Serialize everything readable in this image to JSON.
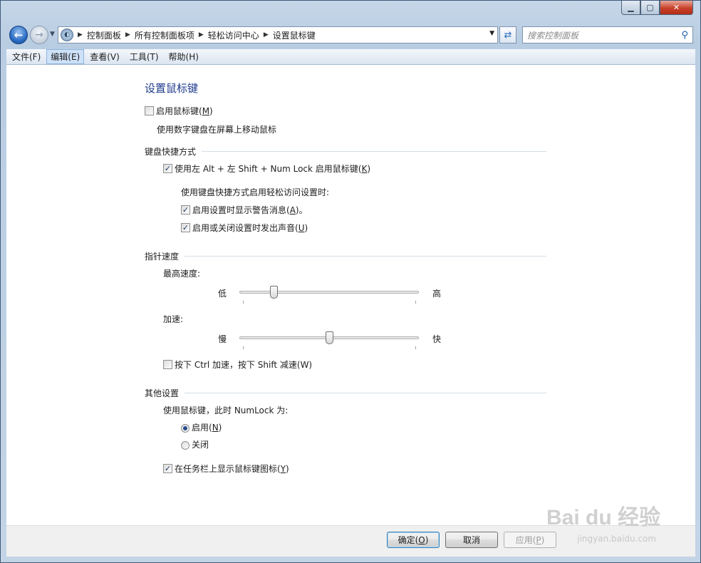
{
  "window": {
    "min": "0",
    "max": "1",
    "close": "r"
  },
  "nav": {
    "back_glyph": "←",
    "forward_glyph": "→",
    "breadcrumbs": [
      "控制面板",
      "所有控制面板项",
      "轻松访问中心",
      "设置鼠标键"
    ],
    "search_placeholder": "搜索控制面板"
  },
  "menu": [
    "文件(F)",
    "编辑(E)",
    "查看(V)",
    "工具(T)",
    "帮助(H)"
  ],
  "page": {
    "title": "设置鼠标键",
    "enable_mouse_keys": {
      "pre": "启用鼠标键(",
      "key": "M",
      "post": ")",
      "checked": false
    },
    "enable_desc": "使用数字键盘在屏幕上移动鼠标",
    "section_shortcut": "键盘快捷方式",
    "shortcut_cb": {
      "pre": "使用左 Alt + 左 Shift + Num Lock 启用鼠标键(",
      "key": "K",
      "post": ")",
      "checked": true
    },
    "shortcut_desc": "使用键盘快捷方式启用轻松访问设置时:",
    "warn_cb": {
      "pre": "启用设置时显示警告消息(",
      "key": "A",
      "post": ")。",
      "checked": true
    },
    "sound_cb": {
      "pre": "启用或关闭设置时发出声音(",
      "key": "U",
      "post": ")",
      "checked": true
    },
    "section_speed": "指针速度",
    "top_speed_label": "最高速度:",
    "top_speed_low": "低",
    "top_speed_high": "高",
    "top_speed_value": 0.18,
    "accel_label": "加速:",
    "accel_low": "慢",
    "accel_high": "快",
    "accel_value": 0.5,
    "ctrl_shift_cb": {
      "text": "按下 Ctrl 加速，按下 Shift 减速(W)",
      "checked": false
    },
    "section_other": "其他设置",
    "numlock_label": "使用鼠标键，此时 NumLock 为:",
    "radio_on": {
      "pre": "启用(",
      "key": "N",
      "post": ")",
      "checked": true
    },
    "radio_off": {
      "text": "关闭",
      "checked": false
    },
    "taskbar_cb": {
      "pre": "在任务栏上显示鼠标键图标(",
      "key": "Y",
      "post": ")",
      "checked": true
    }
  },
  "buttons": {
    "ok": {
      "pre": "确定(",
      "key": "O",
      "post": ")"
    },
    "cancel": "取消",
    "apply": {
      "pre": "应用(",
      "key": "P",
      "post": ")"
    }
  },
  "watermark": {
    "logo": "Bai du 经验",
    "url": "jingyan.baidu.com"
  }
}
